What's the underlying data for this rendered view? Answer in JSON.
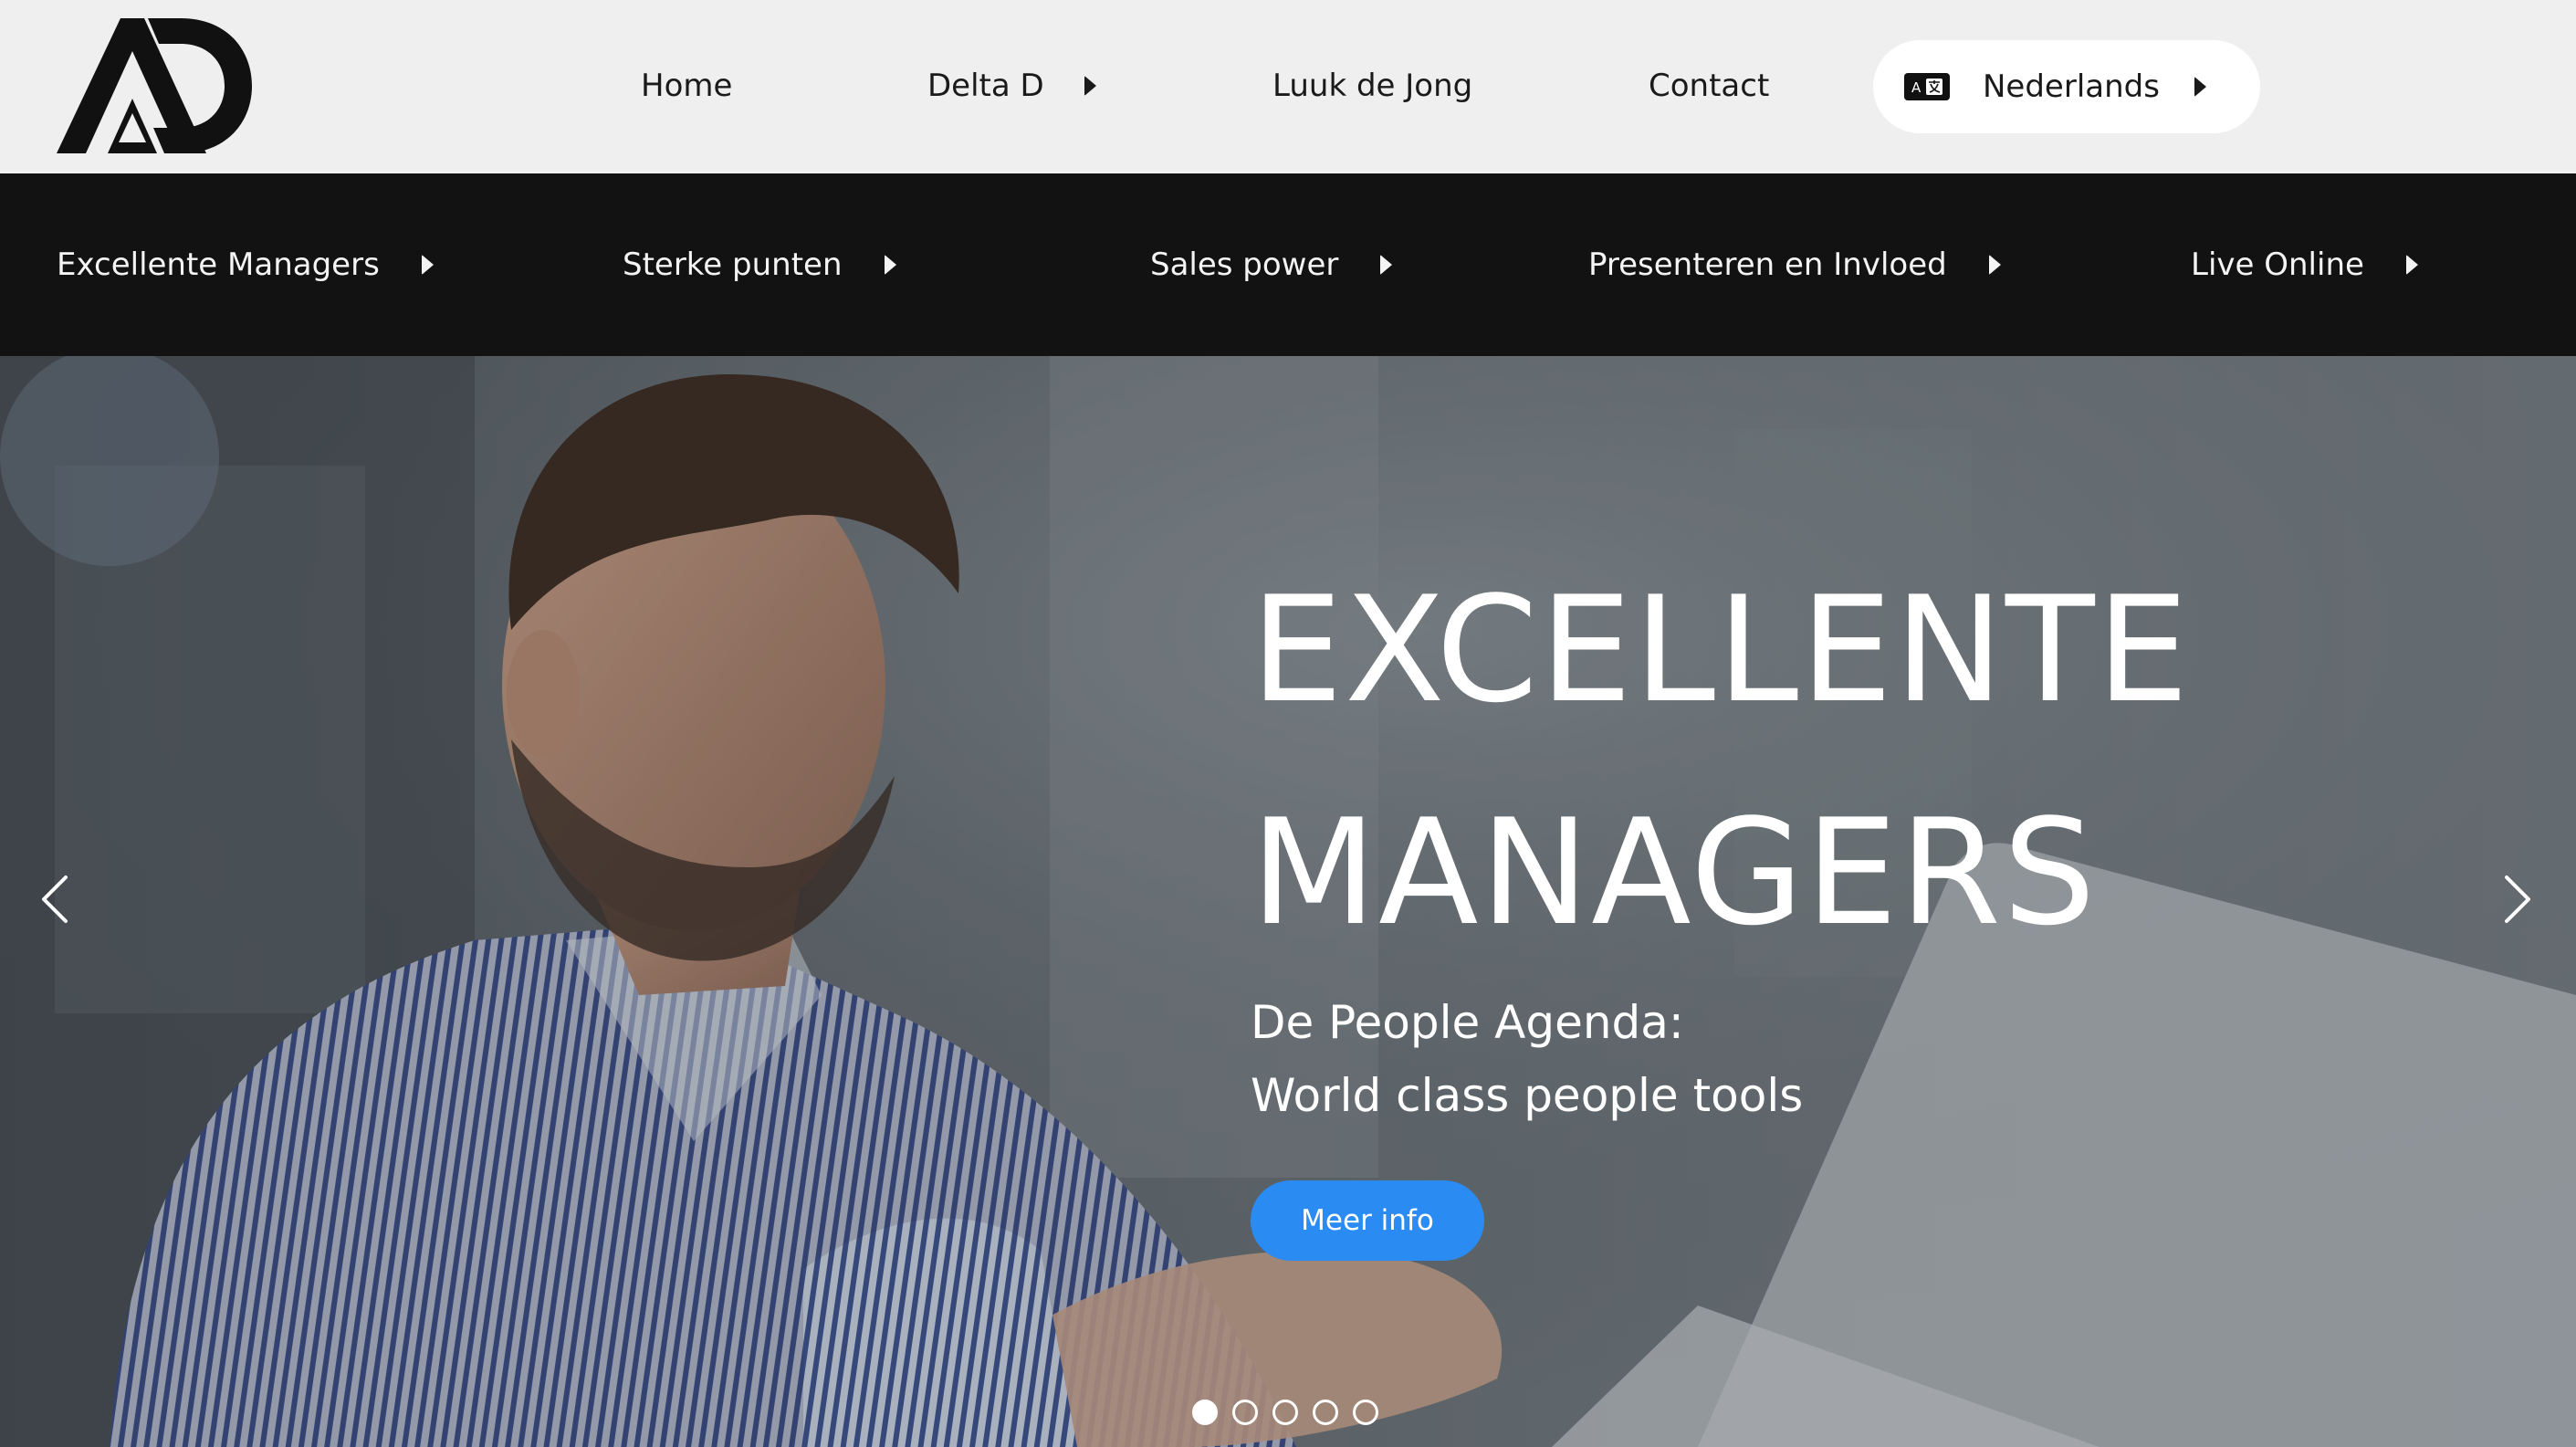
{
  "brand": {
    "logo_icon": "ad-logo"
  },
  "top_nav": {
    "items": [
      {
        "label": "Home"
      },
      {
        "label": "Delta D",
        "has_submenu": true
      },
      {
        "label": "Luuk de Jong"
      },
      {
        "label": "Contact"
      }
    ],
    "language": {
      "label": "Nederlands",
      "icon": "translate-icon",
      "has_submenu": true
    }
  },
  "sub_nav": {
    "items": [
      {
        "label": "Excellente Managers"
      },
      {
        "label": "Sterke punten"
      },
      {
        "label": "Sales power"
      },
      {
        "label": "Presenteren en Invloed"
      },
      {
        "label": "Live Online"
      }
    ]
  },
  "hero": {
    "title_line1": "EXCELLENTE",
    "title_line2": "MANAGERS",
    "subtitle_line1": "De People Agenda:",
    "subtitle_line2": "World class people tools",
    "button_label": "Meer info",
    "slide_count": 5,
    "active_slide": 1
  },
  "colors": {
    "topbar_bg": "#efeff0",
    "subnav_bg": "#121212",
    "accent": "#2a8cf2",
    "text_dark": "#1a1a1a",
    "text_light": "#ffffff"
  }
}
